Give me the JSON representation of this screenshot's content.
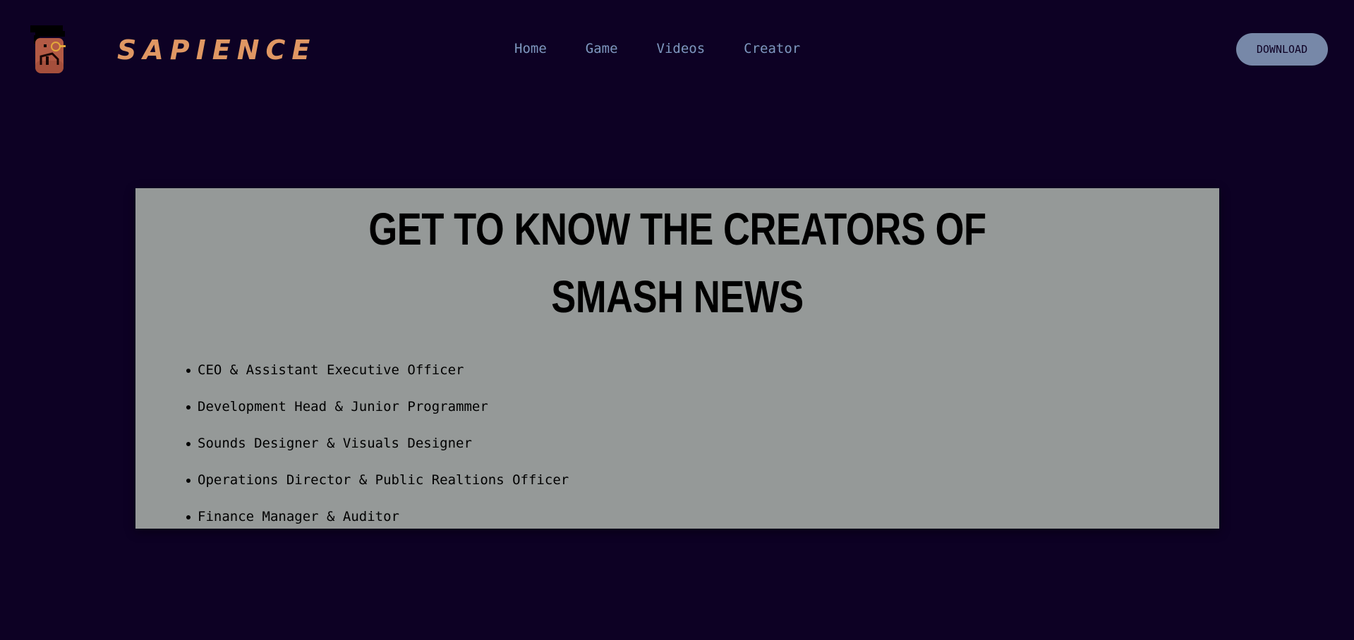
{
  "brand": {
    "name": "SAPIENCE",
    "logo_icon": "pixel-character-icon"
  },
  "nav": {
    "links": [
      {
        "label": "Home"
      },
      {
        "label": "Game"
      },
      {
        "label": "Videos"
      },
      {
        "label": "Creator"
      }
    ],
    "download_label": "DOWNLOAD"
  },
  "main": {
    "title_line1": "GET TO KNOW THE CREATORS OF",
    "title_line2": "SMASH NEWS",
    "roles": [
      "CEO & Assistant Executive Officer",
      "Development Head & Junior Programmer",
      "Sounds Designer & Visuals Designer",
      "Operations Director & Public Realtions Officer",
      "Finance Manager & Auditor"
    ]
  },
  "colors": {
    "page_background": "#0d0124",
    "brand_accent": "#e09763",
    "nav_link": "#7e97bf",
    "button_background": "#7788a8",
    "card_background": "#959998"
  }
}
